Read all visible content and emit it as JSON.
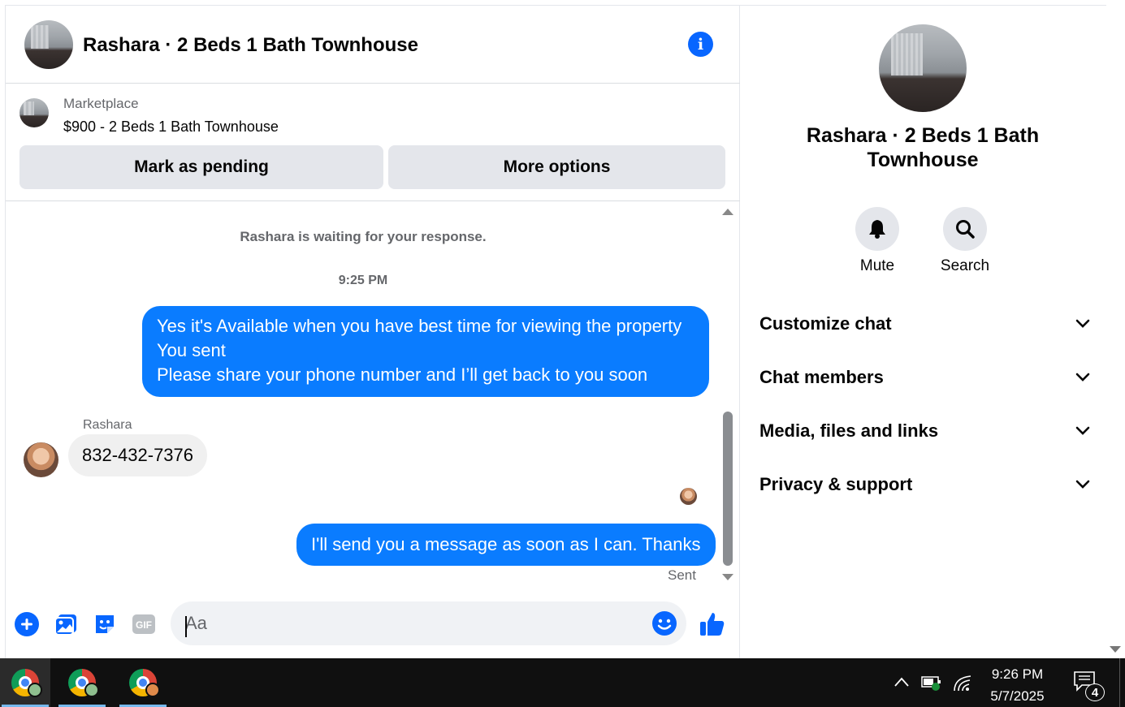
{
  "conversation": {
    "title": "Rashara · 2 Beds 1 Bath Townhouse",
    "info_icon": "info-icon"
  },
  "listing": {
    "source": "Marketplace",
    "price_title": "$900 - 2 Beds 1 Bath Townhouse",
    "mark_pending_label": "Mark as pending",
    "more_options_label": "More options"
  },
  "messages": {
    "waiting_notice": "Rashara is waiting for your response.",
    "time_divider": "9:25 PM",
    "outgoing_1": [
      "Yes it's Available when you have best time for viewing the property",
      "You sent",
      "Please share your phone number and I’ll get back to you soon"
    ],
    "incoming_sender": "Rashara",
    "incoming_1": "832-432-7376",
    "outgoing_2": "I'll send you a message as soon as I can. Thanks",
    "status": "Sent"
  },
  "composer": {
    "placeholder": "Aa",
    "value": "",
    "colors": {
      "accent": "#0866ff"
    }
  },
  "details": {
    "title": "Rashara · 2 Beds 1 Bath Townhouse",
    "mute_label": "Mute",
    "search_label": "Search",
    "sections": [
      "Customize chat",
      "Chat members",
      "Media, files and links",
      "Privacy & support"
    ]
  },
  "taskbar": {
    "time": "9:26 PM",
    "date": "5/7/2025",
    "notification_count": "4",
    "apps": [
      "chrome",
      "chrome",
      "chrome"
    ]
  }
}
